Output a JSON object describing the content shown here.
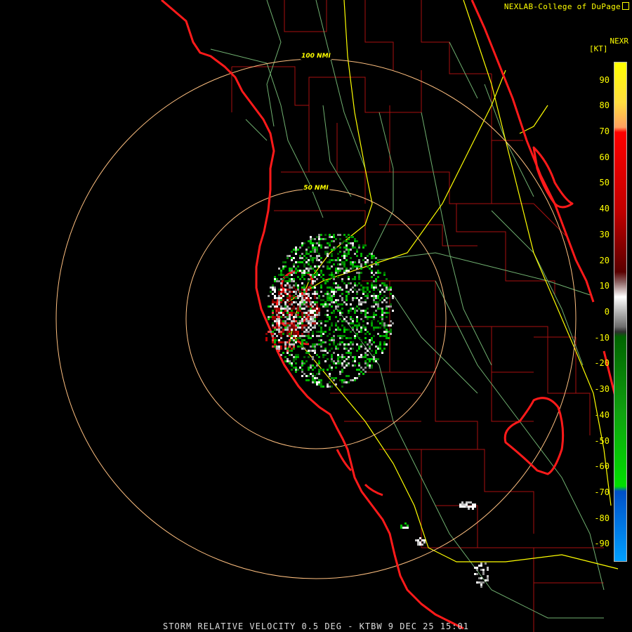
{
  "credit": "NEXLAB-College of DuPage",
  "product_code": "NEXR",
  "unit": "[KT]",
  "footer": "STORM RELATIVE VELOCITY 0.5 DEG - KTBW 9 DEC 25 15:01",
  "rings": {
    "inner": "50 NMI",
    "outer": "100 NMI"
  },
  "legend": {
    "ticks": [
      90,
      80,
      70,
      60,
      50,
      40,
      30,
      20,
      10,
      0,
      -10,
      -20,
      -30,
      -40,
      -50,
      -60,
      -70,
      -80,
      -90
    ],
    "range": [
      -97,
      97
    ],
    "colors": {
      "top": "#ffff00",
      "orange": "#ffa060",
      "red": "#ff0000",
      "darkred": "#5a0000",
      "white": "#ffffff",
      "gray": "#6e6e6e",
      "darkgreen": "#006400",
      "green": "#00e000",
      "blue": "#0050c8",
      "lightblue": "#00a0ff"
    }
  },
  "map_colors": {
    "coast": "#ff1a1a",
    "county": "#b01010",
    "highway": "#ffff00",
    "road": "#80c080",
    "ring": "#ffc080"
  }
}
